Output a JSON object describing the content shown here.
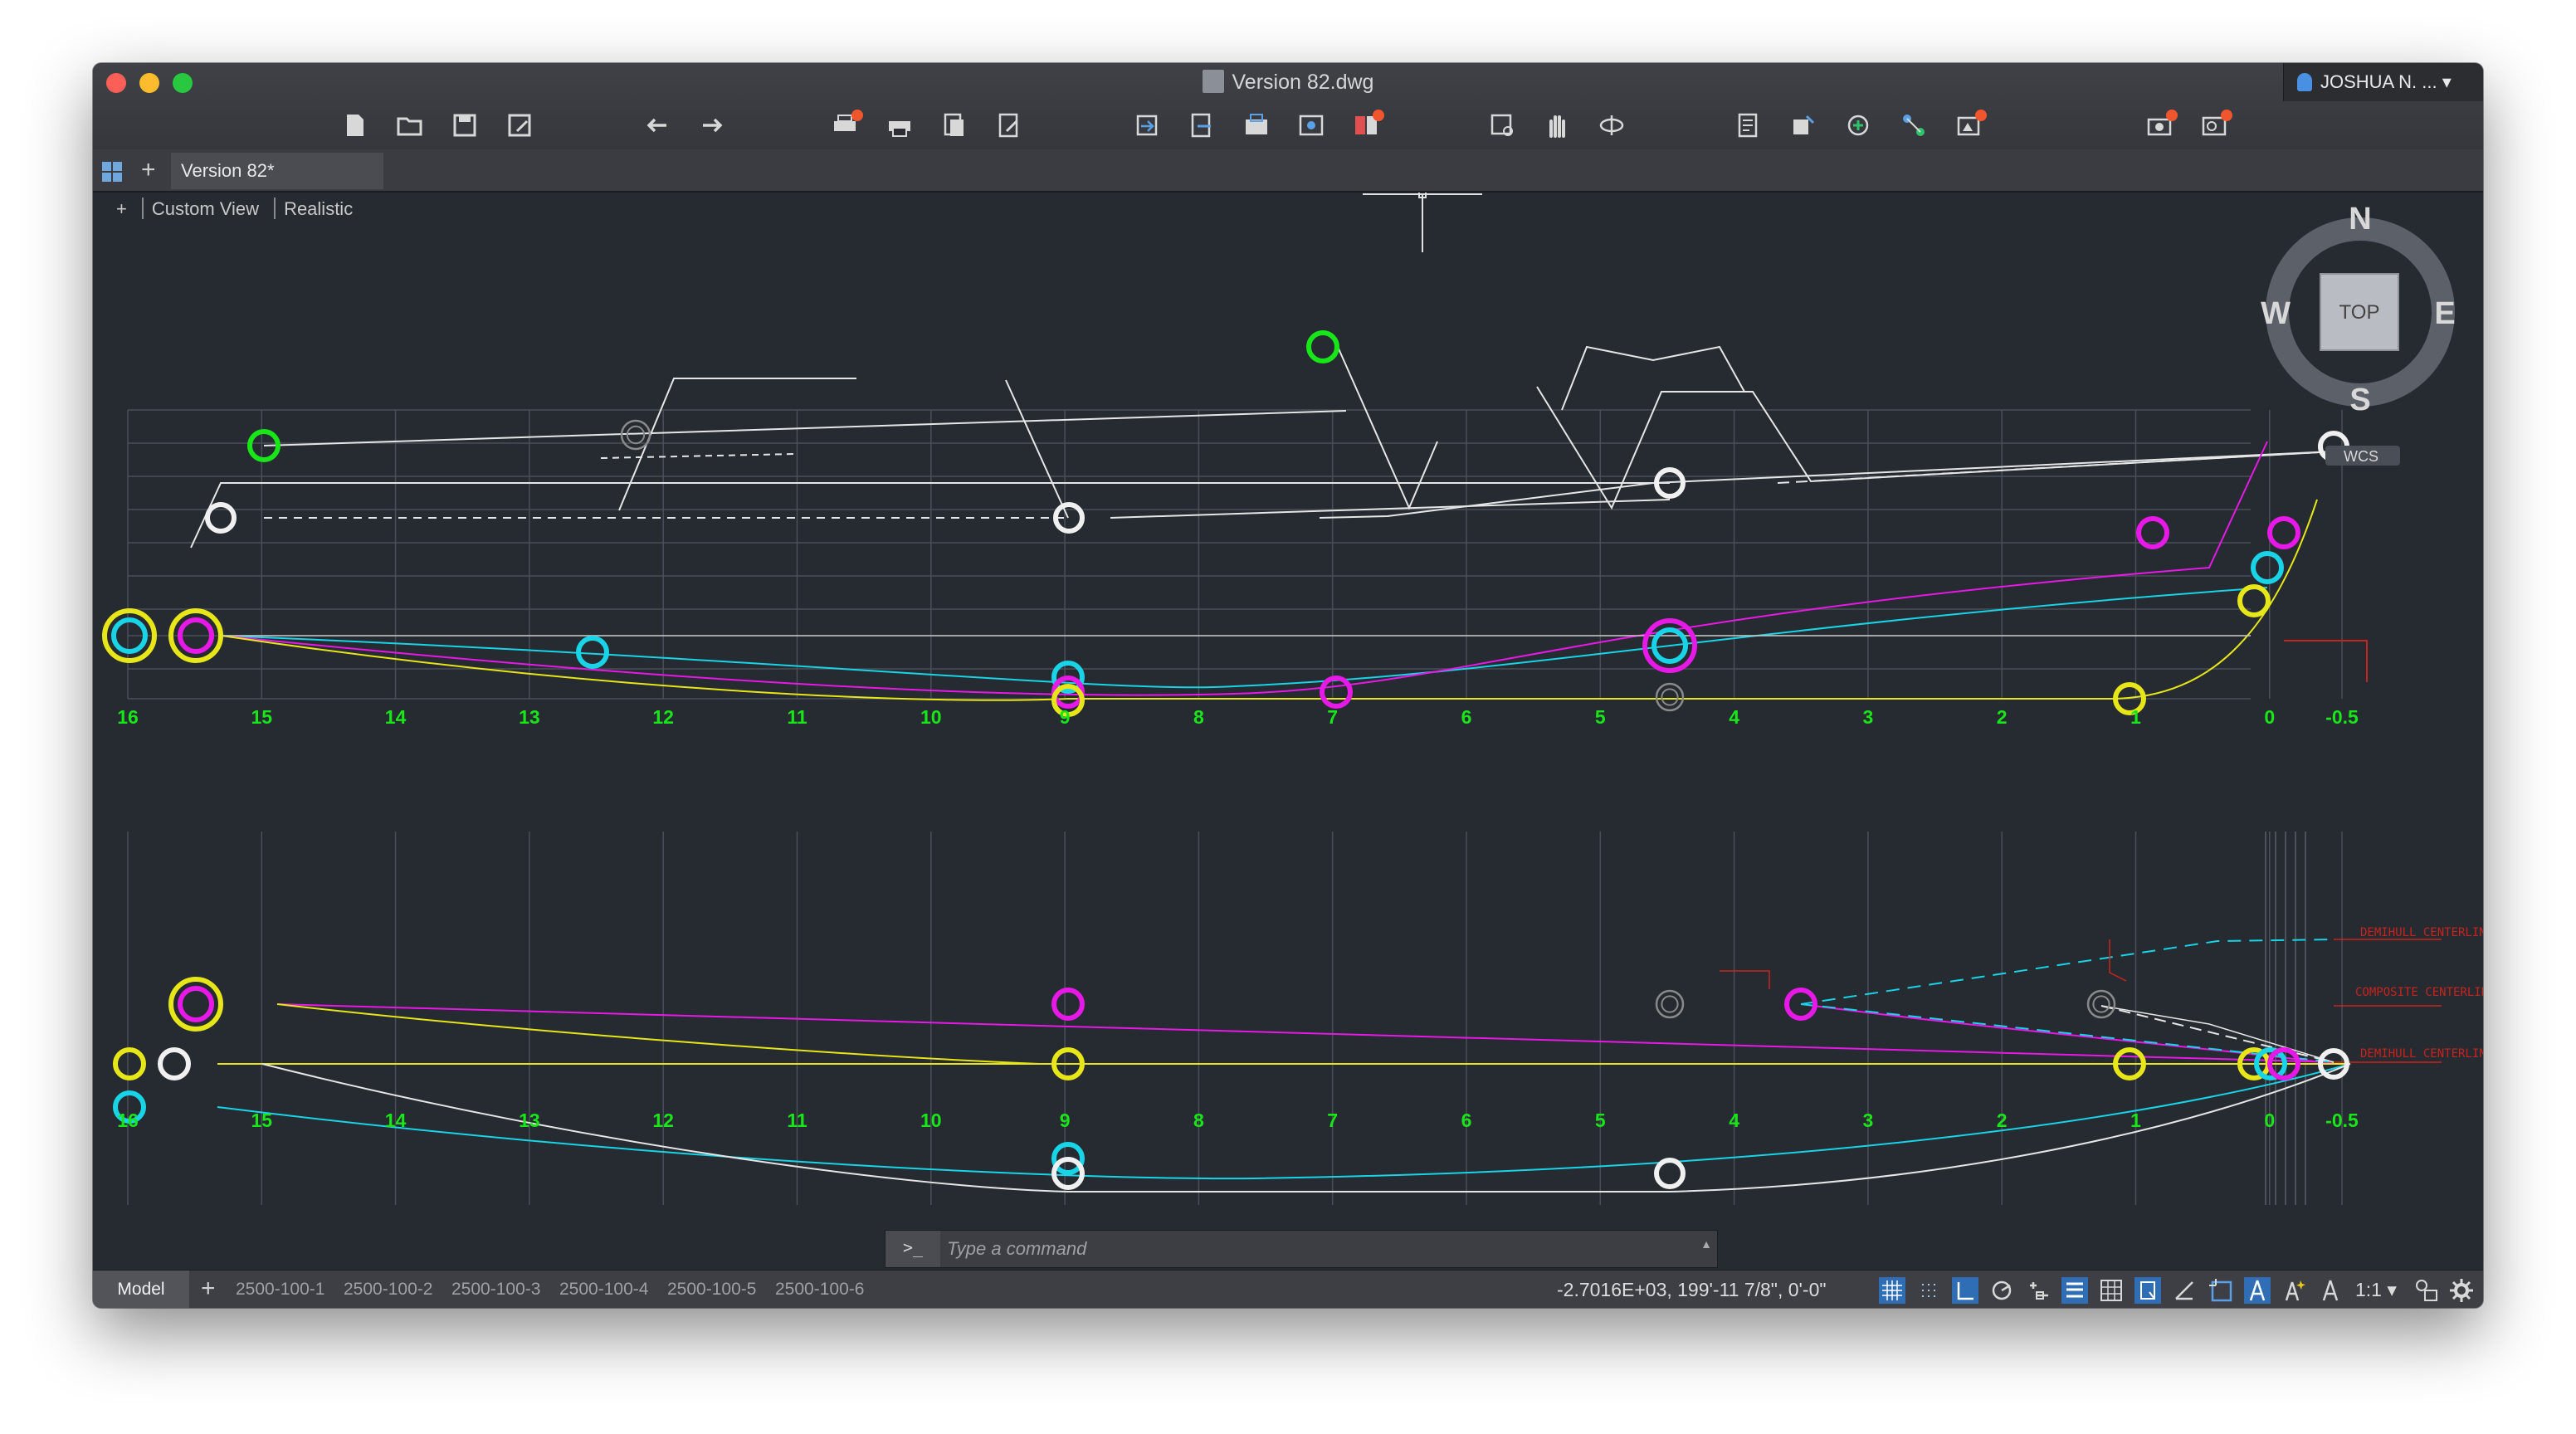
{
  "window": {
    "title": "Version 82.dwg",
    "user": "JOSHUA N. ..."
  },
  "toolbar": {
    "buttons": [
      "new-file-icon",
      "open-folder-icon",
      "save-icon",
      "save-as-icon",
      "undo-icon",
      "redo-icon",
      "plot-icon",
      "print-icon",
      "publish-icon",
      "page-setup-icon",
      "import-icon",
      "export-icon",
      "xref-icon",
      "attach-icon",
      "layer-icon",
      "zoom-window-icon",
      "pan-hand-icon",
      "orbit-icon",
      "properties-icon",
      "block-icon",
      "add-icon",
      "network-icon",
      "render-icon",
      "settings-icon",
      "cloud-icon"
    ]
  },
  "tabs": {
    "document": "Version 82*"
  },
  "view": {
    "plus": "+",
    "view_name": "Custom View",
    "visual_style": "Realistic"
  },
  "viewcube": {
    "north": "N",
    "south": "S",
    "east": "E",
    "west": "W",
    "face": "TOP",
    "ucs": "WCS"
  },
  "station_labels": [
    "16",
    "15",
    "14",
    "13",
    "12",
    "11",
    "10",
    "9",
    "8",
    "7",
    "6",
    "5",
    "4",
    "3",
    "2",
    "1",
    "0",
    "-0.5"
  ],
  "annotations": {
    "centerline_1": "DEMIHULL CENTERLINE",
    "centerline_2": "COMPOSITE CENTERLINE",
    "centerline_3": "DEMIHULL CENTERLINE"
  },
  "colors": {
    "green": "#19e619",
    "yellow": "#e6e619",
    "cyan": "#19d4e6",
    "magenta": "#e619e6",
    "white": "#f0f0f0",
    "red": "#c8241e",
    "grid": "#4a4f58"
  },
  "command": {
    "prompt": ">_",
    "placeholder": "Type a command"
  },
  "status": {
    "model_tab": "Model",
    "layouts": [
      "2500-100-1",
      "2500-100-2",
      "2500-100-3",
      "2500-100-4",
      "2500-100-5",
      "2500-100-6"
    ],
    "coordinates": "-2.7016E+03,  199'-11 7/8\", 0'-0\"",
    "scale": "1:1"
  }
}
